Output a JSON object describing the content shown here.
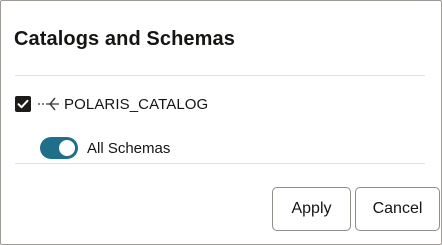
{
  "dialog": {
    "title": "Catalogs and Schemas"
  },
  "catalog": {
    "name": "POLARIS_CATALOG",
    "checked": true,
    "icon": "tree-collapse-icon"
  },
  "schemas": {
    "label": "All Schemas",
    "toggle_on": true,
    "toggle_color": "#1f6f8b"
  },
  "footer": {
    "apply_label": "Apply",
    "cancel_label": "Cancel"
  }
}
